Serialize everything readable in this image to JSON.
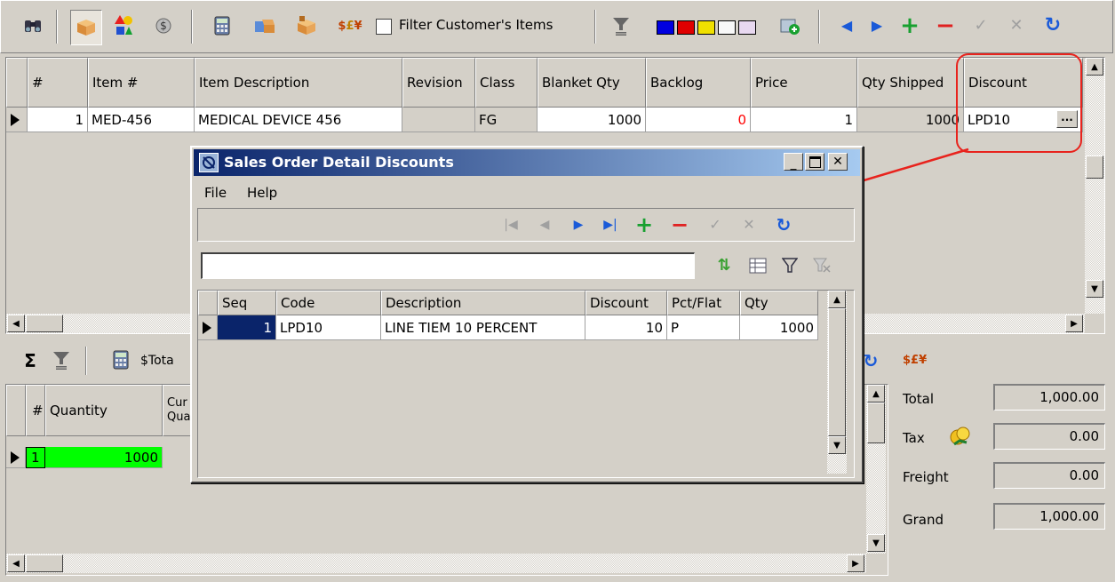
{
  "toolbar": {
    "filter_label": "Filter Customer's Items",
    "filter_checked": false,
    "icons": [
      "binoculars-icon",
      "package-icon",
      "shapes-icon",
      "dollar-icon",
      "calculator-icon",
      "cart-icon",
      "box-icon",
      "currency-icon",
      "filter-icon",
      "color-swatches-icon",
      "add-row-icon",
      "prev-icon",
      "next-icon",
      "plus-icon",
      "minus-icon",
      "check-icon",
      "cancel-icon",
      "refresh-icon"
    ]
  },
  "main_grid": {
    "columns": [
      "#",
      "Item #",
      "Item Description",
      "Revision",
      "Class",
      "Blanket Qty",
      "Backlog",
      "Price",
      "Qty Shipped",
      "Discount"
    ],
    "rows": [
      {
        "num": "1",
        "item": "MED-456",
        "description": "MEDICAL DEVICE 456",
        "revision": "",
        "class": "FG",
        "blanket_qty": "1000",
        "backlog": "0",
        "price": "1",
        "qty_shipped": "1000",
        "discount": "LPD10"
      }
    ],
    "ellipsis": "..."
  },
  "bottom_toolbar": {
    "sigma": "Σ",
    "total_label": "$Tota"
  },
  "release_grid": {
    "columns": [
      "#",
      "Quantity",
      "Cur Qua"
    ],
    "rows": [
      {
        "num": "1",
        "quantity": "1000"
      }
    ]
  },
  "totals": {
    "currency_symbol": "$£¥",
    "total_label": "Total",
    "total_value": "1,000.00",
    "tax_label": "Tax",
    "tax_value": "0.00",
    "freight_label": "Freight",
    "freight_value": "0.00",
    "grand_label": "Grand",
    "grand_value": "1,000.00"
  },
  "dialog": {
    "title": "Sales Order Detail Discounts",
    "menu": [
      "File",
      "Help"
    ],
    "search_value": "",
    "columns": [
      "Seq",
      "Code",
      "Description",
      "Discount",
      "Pct/Flat",
      "Qty"
    ],
    "rows": [
      {
        "seq": "1",
        "code": "LPD10",
        "description": "LINE TIEM 10 PERCENT",
        "discount": "10",
        "pct_flat": "P",
        "qty": "1000"
      }
    ]
  },
  "colors": {
    "annotation": "#e8231d",
    "title_start": "#0a246a",
    "title_end": "#a6caf0",
    "selected_cell": "#0a246a",
    "green_cell": "#00ff00",
    "backlog_red": "#ff0000"
  }
}
